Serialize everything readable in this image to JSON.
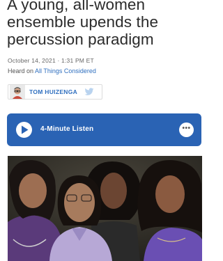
{
  "article": {
    "headline": "A young, all-women ensemble upends the percussion paradigm",
    "dateline": "October 14, 2021 · 1:31 PM ET",
    "heard_on_prefix": "Heard on ",
    "heard_on_program": "All Things Considered"
  },
  "byline": {
    "author": "TOM HUIZENGA",
    "avatar_icon": "author-avatar",
    "social_icon": "twitter-icon"
  },
  "audio": {
    "label": "4-Minute Listen",
    "play_icon": "play-icon",
    "more_icon": "more-icon",
    "more_glyph": "•••"
  },
  "colors": {
    "accent": "#2a63b4",
    "link": "#2f6fbf"
  }
}
